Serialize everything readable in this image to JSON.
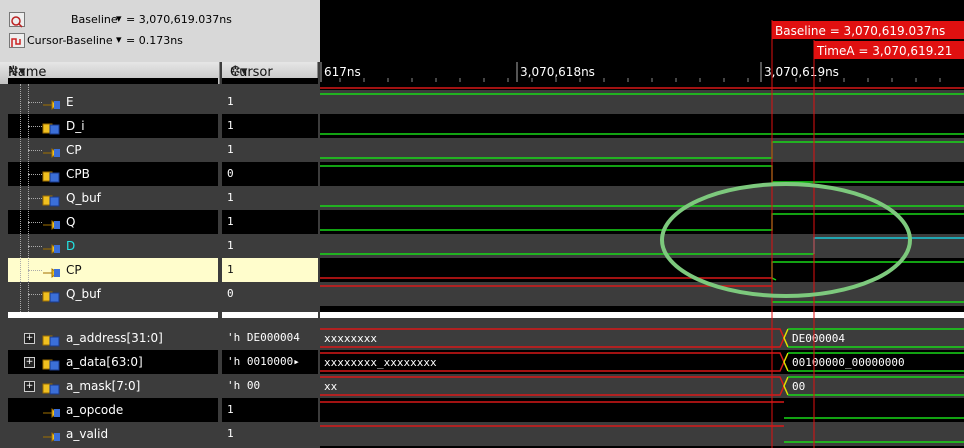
{
  "toolbar": {
    "baseline_label": "Baseline",
    "baseline_value": "= 3,070,619.037ns",
    "delta_label": "Cursor-Baseline",
    "delta_value": "= 0.173ns"
  },
  "headers": {
    "name": "Name",
    "cursor": "Cursor"
  },
  "signals": [
    {
      "name": "E",
      "cursor": "1",
      "icon": "arrow-in-icon"
    },
    {
      "name": "D_i",
      "cursor": "1",
      "icon": "wire-icon"
    },
    {
      "name": "CP",
      "cursor": "1",
      "icon": "arrow-in-icon"
    },
    {
      "name": "CPB",
      "cursor": "0",
      "icon": "wire-icon"
    },
    {
      "name": "Q_buf",
      "cursor": "1",
      "icon": "wire-icon"
    },
    {
      "name": "Q",
      "cursor": "1",
      "icon": "arrow-out-icon"
    },
    {
      "name": "D",
      "cursor": "1",
      "icon": "arrow-out-icon"
    },
    {
      "name": "CP",
      "cursor": "1",
      "icon": "arrow-in-icon"
    },
    {
      "name": "Q_buf",
      "cursor": "0",
      "icon": "wire-icon"
    }
  ],
  "buses": [
    {
      "name": "a_address[31:0]",
      "cursor": "'h DE000004",
      "pre_value": "xxxxxxxx",
      "post_value": "DE000004"
    },
    {
      "name": "a_data[63:0]",
      "cursor": "'h 0010000▸",
      "pre_value": "xxxxxxxx_xxxxxxxx",
      "post_value": "00100000_00000000"
    },
    {
      "name": "a_mask[7:0]",
      "cursor": "'h 00",
      "pre_value": "xx",
      "post_value": "00"
    },
    {
      "name": "a_opcode",
      "cursor": "1",
      "pre_value": "",
      "post_value": ""
    },
    {
      "name": "a_valid",
      "cursor": "1",
      "pre_value": "",
      "post_value": ""
    }
  ],
  "timeline": {
    "tick_labels": [
      "617ns",
      "3,070,618ns",
      "3,070,619ns"
    ],
    "baseline_marker": "Baseline = 3,070,619.037ns",
    "timea_marker": "TimeA = 3,070,619.21"
  },
  "colors": {
    "wave_green": "#18d818",
    "wave_red": "#d81818",
    "wave_cyan": "#18c8d8",
    "marker_red": "#e01010",
    "highlight_ellipse": "#7dc97d"
  }
}
